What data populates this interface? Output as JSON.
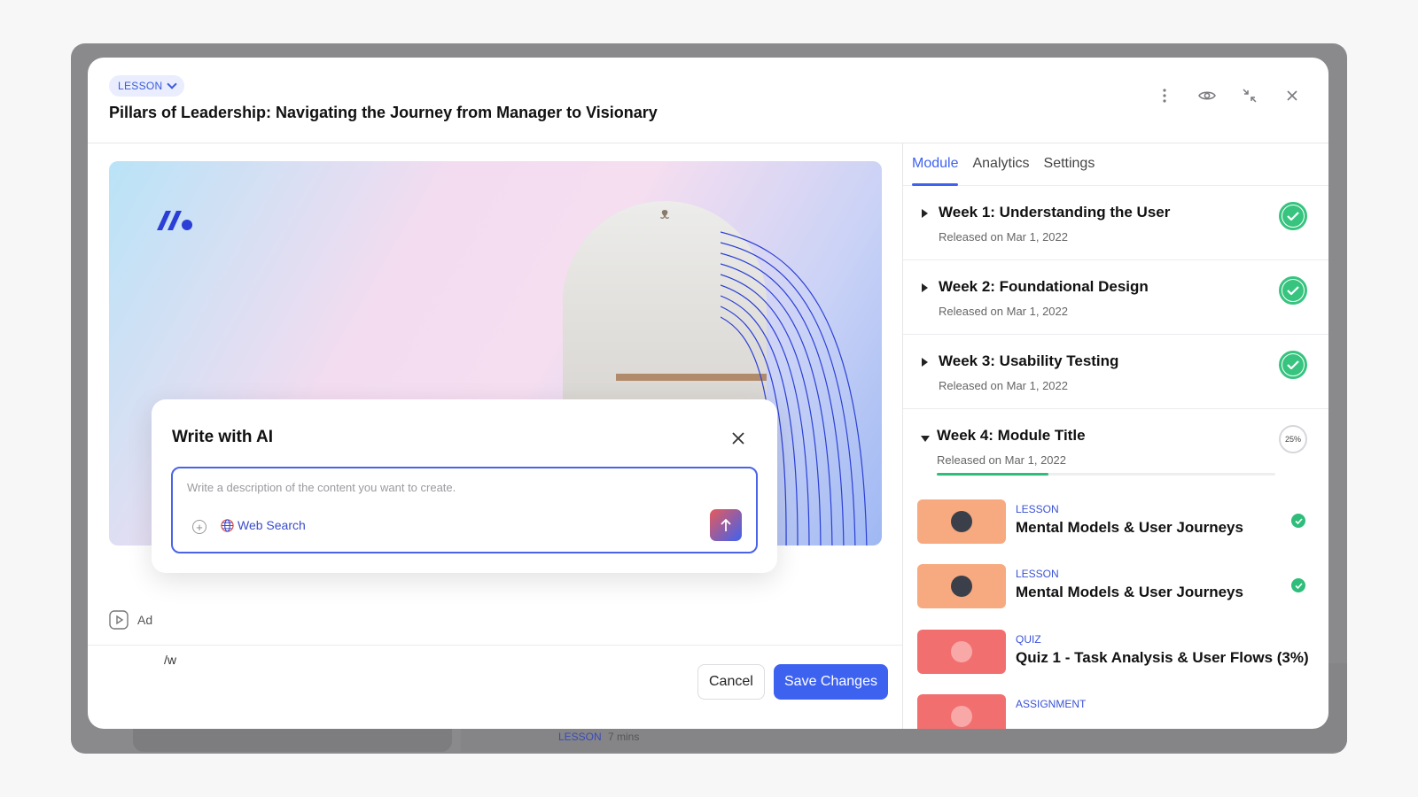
{
  "header": {
    "type_chip": "LESSON",
    "title": "Pillars of Leadership: Navigating the Journey from Manager to Visionary",
    "icons": [
      "more-vertical-icon",
      "eye-icon",
      "collapse-icon",
      "close-icon"
    ]
  },
  "editor": {
    "add_label": "Ad",
    "slash_text": "/w"
  },
  "ai_popup": {
    "title": "Write with AI",
    "placeholder": "Write a description of the content you want to create.",
    "web_search": "Web Search"
  },
  "footer": {
    "cancel": "Cancel",
    "save": "Save Changes"
  },
  "sidebar": {
    "tabs": [
      "Module",
      "Analytics",
      "Settings"
    ],
    "active_tab": "Module",
    "weeks": [
      {
        "title": "Week 1: Understanding the User",
        "released": "Released on Mar 1, 2022",
        "status": "complete"
      },
      {
        "title": "Week 2: Foundational Design",
        "released": "Released on Mar 1, 2022",
        "status": "complete"
      },
      {
        "title": "Week 3: Usability Testing",
        "released": "Released on Mar 1, 2022",
        "status": "complete"
      },
      {
        "title": "Week 4: Module Title",
        "released": "Released on Mar 1, 2022",
        "status": "in-progress",
        "progress_label": "25%",
        "progress": 0.33
      }
    ],
    "items": [
      {
        "type": "LESSON",
        "title": "Mental Models & User Journeys",
        "done": true,
        "color": "#f7a97f"
      },
      {
        "type": "LESSON",
        "title": "Mental Models & User Journeys",
        "done": true,
        "color": "#f7a97f"
      },
      {
        "type": "QUIZ",
        "title": "Quiz 1 - Task Analysis & User Flows (3%)",
        "done": false,
        "color": "#f26f6f"
      },
      {
        "type": "ASSIGNMENT",
        "title": "",
        "done": false,
        "color": "#f26f6f"
      }
    ]
  },
  "background": {
    "peek_label": "LESSON",
    "peek_mins": "7 mins"
  },
  "colors": {
    "accent": "#3e62f0",
    "success": "#37c47f"
  }
}
